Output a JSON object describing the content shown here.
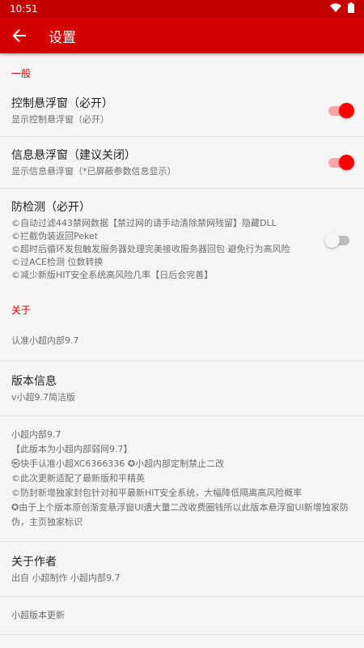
{
  "status_bar": {
    "time": "10:51",
    "icons": [
      "wifi-icon",
      "battery-icon"
    ]
  },
  "app_bar": {
    "back_icon": "arrow-left-icon",
    "title": "设置"
  },
  "colors": {
    "accent": "#d50000",
    "switch_on_thumb": "#ff0000"
  },
  "general": {
    "category": "一般",
    "control_float": {
      "title": "控制悬浮窗（必开）",
      "summary": "显示控制悬浮窗（必开）",
      "enabled": true
    },
    "info_float": {
      "title": "信息悬浮窗（建议关闭）",
      "summary": "显示信息悬浮窗（*已屏蔽参数信息显示）",
      "enabled": true
    },
    "anti_detect": {
      "title": "防检测（必开）",
      "summary": "©自动过滤443禁网数据【禁过网的请手动清除禁网残留】隐藏DLL\n©拦截伪装返回Peket\n©超时后循环发包触发服务器处理完美接收服务器回包 避免行为高风险\n©过ACE检测 位数转换\n©减少新版HIT安全系统高风险几率【日后会完善】",
      "enabled": false
    }
  },
  "about": {
    "category": "关于",
    "auth": "认准小超内部9.7",
    "version": {
      "title": "版本信息",
      "summary": "v小超9.7简洁版"
    },
    "notes": "小超内部9.7\n【此版本为小超内部弱网9.7】\n㉿快手认准小超XC6366336 ✪小超内部定制禁止二改\n©此次更新适配了最新版和平精英\n©防封新增独家封包针对和平最新HIT安全系统，大幅降低隔离高风险概率\n✪由于上个版本原创渐变悬浮窗UI遭大量二改收费圈钱所以此版本悬浮窗UI新增独家防伪，主页独家标识",
    "author": {
      "title": "关于作者",
      "summary": "出自 小超制作 小超内部9.7"
    },
    "update": "小超版本更新"
  }
}
